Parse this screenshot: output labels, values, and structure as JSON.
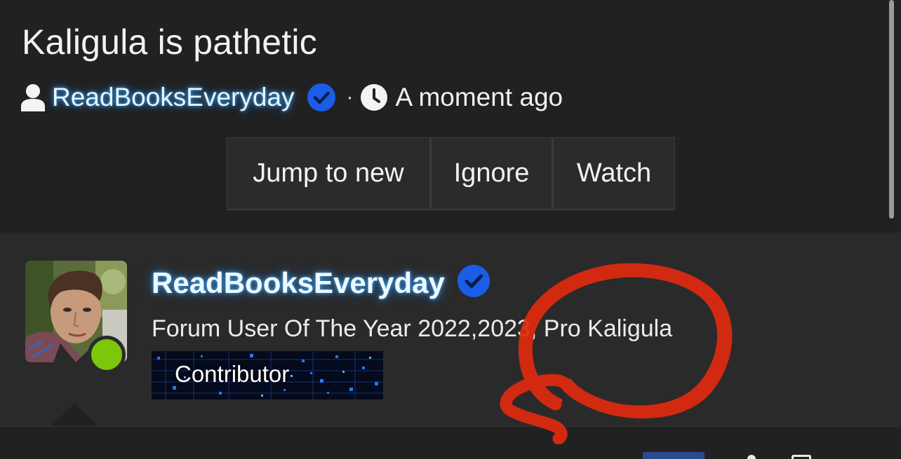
{
  "thread": {
    "title": "Kaligula is pathetic",
    "author": "ReadBooksEveryday",
    "separator": "·",
    "time": "A moment ago"
  },
  "actions": {
    "jump_label": "Jump to new",
    "ignore_label": "Ignore",
    "watch_label": "Watch"
  },
  "post": {
    "author": "ReadBooksEveryday",
    "user_title": "Forum User Of The Year 2022,2023, Pro Kaligula",
    "banner_label": "Contributor",
    "online": true
  },
  "icons": {
    "user": "user-icon",
    "verified": "verified-badge-icon",
    "clock": "clock-icon"
  },
  "colors": {
    "background": "#212121",
    "post_background": "#2a2a2a",
    "verified_blue": "#1a5ee8",
    "online_green": "#7cc70a",
    "name_glow": "#46b4ff",
    "annotation_red": "#e02a0e"
  }
}
